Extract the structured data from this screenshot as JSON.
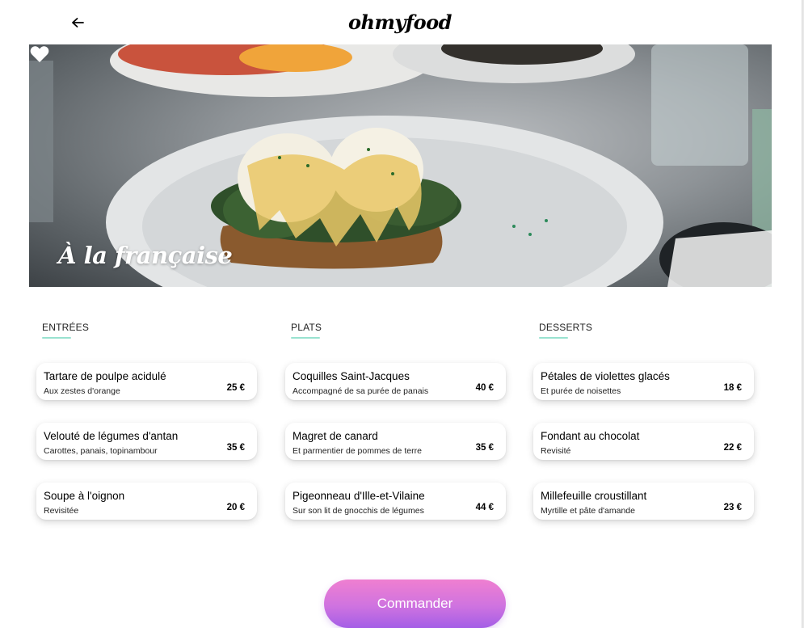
{
  "header": {
    "back_icon": "arrow-left-icon",
    "logo": "ohmyfood"
  },
  "hero": {
    "title": "À la française",
    "favorite_icon": "heart-icon"
  },
  "menu": {
    "columns": [
      {
        "title": "ENTRÉES",
        "items": [
          {
            "name": "Tartare de poulpe acidulé",
            "description": "Aux zestes d'orange",
            "price": "25 €"
          },
          {
            "name": "Velouté de légumes d'antan",
            "description": "Carottes, panais, topinambour",
            "price": "35 €"
          },
          {
            "name": "Soupe à l'oignon",
            "description": "Revisitée",
            "price": "20 €"
          }
        ]
      },
      {
        "title": "PLATS",
        "items": [
          {
            "name": "Coquilles Saint-Jacques",
            "description": "Accompagné de sa purée de panais",
            "price": "40 €"
          },
          {
            "name": "Magret de canard",
            "description": "Et parmentier de pommes de terre",
            "price": "35 €"
          },
          {
            "name": "Pigeonneau d'Ille-et-Vilaine",
            "description": "Sur son lit de gnocchis de légumes",
            "price": "44 €"
          }
        ]
      },
      {
        "title": "DESSERTS",
        "items": [
          {
            "name": "Pétales de violettes glacés",
            "description": "Et purée de noisettes",
            "price": "18 €"
          },
          {
            "name": "Fondant au chocolat",
            "description": "Revisité",
            "price": "22 €"
          },
          {
            "name": "Millefeuille croustillant",
            "description": "Myrtille et pâte d'amande",
            "price": "23 €"
          }
        ]
      }
    ]
  },
  "order_button": {
    "label": "Commander"
  },
  "colors": {
    "accent_underline": "#99e2d0",
    "button_gradient_top": "#ef7fd0",
    "button_gradient_bottom": "#a45ee6"
  }
}
